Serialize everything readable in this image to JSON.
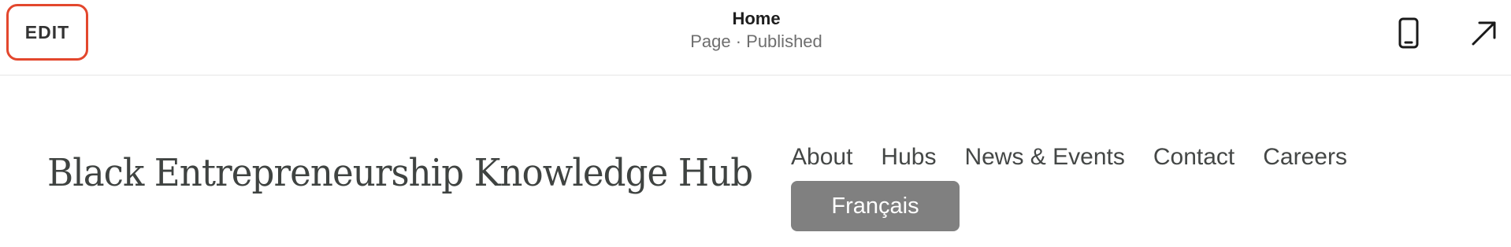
{
  "editor_bar": {
    "edit_label": "EDIT",
    "page_title": "Home",
    "page_status": "Page · Published",
    "icons": {
      "mobile": "mobile-phone-icon",
      "external": "arrow-up-right-icon"
    },
    "accent_color": "#e3472d"
  },
  "site_header": {
    "site_title": "Black Entrepreneurship Knowledge Hub",
    "nav_items": [
      {
        "label": "About"
      },
      {
        "label": "Hubs"
      },
      {
        "label": "News & Events"
      },
      {
        "label": "Contact"
      },
      {
        "label": "Careers"
      }
    ],
    "language_button": "Français",
    "language_button_color": "#808080"
  }
}
